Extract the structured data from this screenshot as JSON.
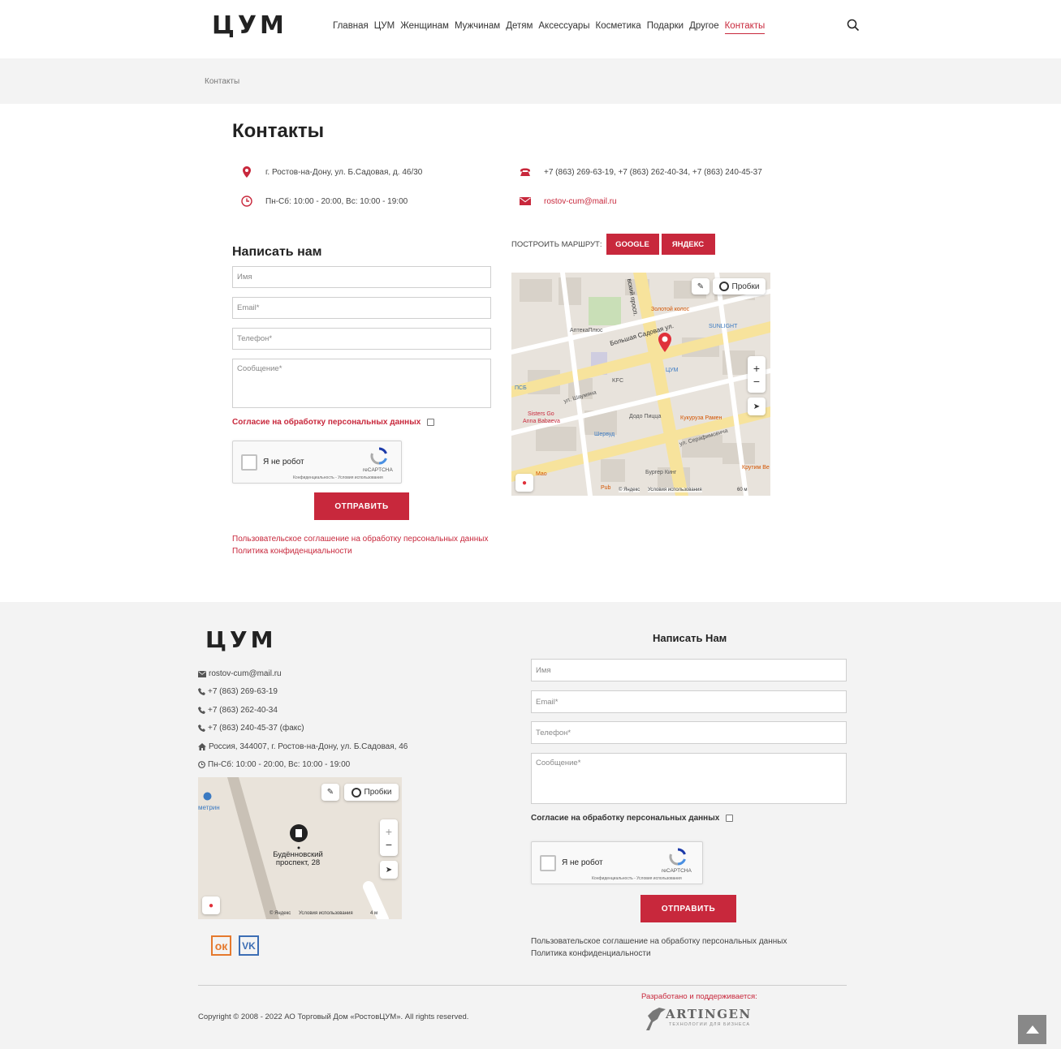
{
  "header": {
    "logo": "ЦУМ",
    "nav": [
      "Главная",
      "ЦУМ",
      "Женщинам",
      "Мужчинам",
      "Детям",
      "Аксессуары",
      "Косметика",
      "Подарки",
      "Другое",
      "Контакты"
    ],
    "active_nav": "Контакты"
  },
  "breadcrumb": "Контакты",
  "page_title": "Контакты",
  "contacts": {
    "address": "г. Ростов-на-Дону, ул. Б.Садовая, д. 46/30",
    "hours": "Пн-Сб: 10:00 - 20:00, Вс: 10:00 - 19:00",
    "phones": "+7 (863) 269-63-19, +7 (863) 262-40-34, +7 (863) 240-45-37",
    "email": "rostov-cum@mail.ru"
  },
  "form": {
    "title": "Написать нам",
    "name_placeholder": "Имя",
    "email_placeholder": "Email*",
    "phone_placeholder": "Телефон*",
    "message_placeholder": "Сообщение*",
    "consent": "Согласие на обработку персональных данных",
    "captcha_label": "Я не робот",
    "captcha_brand": "reCAPTCHA",
    "captcha_terms": "Конфиденциальность - Условия использования",
    "submit": "ОТПРАВИТЬ",
    "link_agreement": "Пользовательское соглашение на обработку персональных данных",
    "link_privacy": "Политика конфиденциальности"
  },
  "route": {
    "label": "ПОСТРОИТЬ МАРШРУТ:",
    "google": "GOOGLE",
    "yandex": "ЯНДЕКС"
  },
  "map_main": {
    "traffic": "Пробки",
    "copyright": "© Яндекс",
    "terms": "Условия использования",
    "scale": "60 м",
    "labels": [
      "Большая Садовая ул.",
      "Золотой колос",
      "SUNLIGHT",
      "АптекаПлюс",
      "ЦУМ",
      "KFC",
      "ул. Шаумяна",
      "Додо Пицца",
      "Кукуруза Рамен",
      "Sisters Go",
      "Anna Babaeva",
      "Шервуд",
      "ул. Серафимовича",
      "Бургер Кинг",
      "Крутим Ве",
      "Мао",
      "Pub",
      "ПСБ",
      "вский просп."
    ]
  },
  "footer": {
    "logo": "ЦУМ",
    "email": "rostov-cum@mail.ru",
    "phone1": "+7 (863) 269-63-19",
    "phone2": "+7 (863) 262-40-34",
    "phone3": "+7 (863) 240-45-37 (факс)",
    "address": "Россия, 344007, г. Ростов-на-Дону, ул. Б.Садовая, 46",
    "hours": "Пн-Сб: 10:00 - 20:00, Вс: 10:00 - 19:00",
    "form_title": "Написать Нам",
    "copyright": "Copyright © 2008 - 2022 АО Торговый Дом «РостовЦУМ». All rights reserved.",
    "developer": "Разработано и поддерживается:",
    "developer_name": "ARTINGEN",
    "developer_tagline": "ТЕХНОЛОГИИ ДЛЯ БИЗНЕСА"
  },
  "map_footer": {
    "traffic": "Пробки",
    "place": "Будённовский проспект, 28",
    "place_line1": "Будённовский",
    "place_line2": "проспект, 28",
    "metro": "метрин",
    "copyright": "© Яндекс",
    "terms": "Условия использования",
    "scale": "4 м"
  },
  "colors": {
    "accent": "#c8283c",
    "footer_bg": "#f3f3f3"
  }
}
